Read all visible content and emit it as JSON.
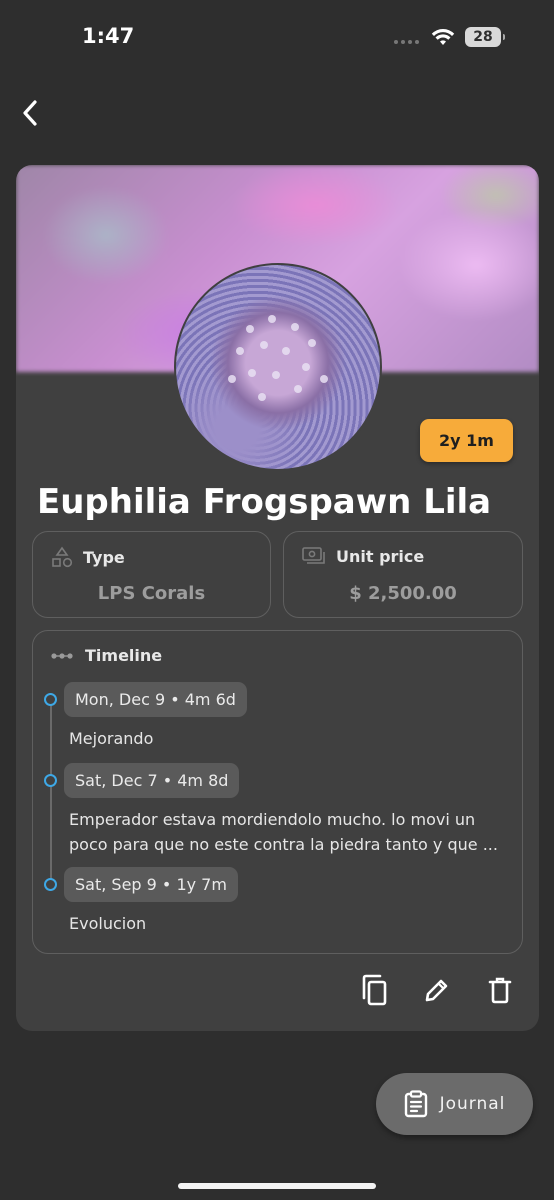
{
  "status_bar": {
    "time": "1:47",
    "battery": "28"
  },
  "nav": {
    "back_icon": "chevron-left-icon"
  },
  "coral": {
    "name": "Euphilia Frogspawn Lila",
    "age_badge": "2y 1m",
    "type_label": "Type",
    "type_value": "LPS Corals",
    "price_label": "Unit price",
    "price_value": "$ 2,500.00"
  },
  "timeline": {
    "label": "Timeline",
    "entries": [
      {
        "date": "Mon, Dec 9 • 4m 6d",
        "note": "Mejorando"
      },
      {
        "date": "Sat, Dec 7 • 4m 8d",
        "note": "Emperador estava mordiendolo mucho. lo movi un poco para que no este contra la piedra tanto y que ..."
      },
      {
        "date": "Sat, Sep 9 • 1y 7m",
        "note": "Evolucion"
      }
    ]
  },
  "actions": {
    "copy_icon": "copy-icon",
    "edit_icon": "pencil-icon",
    "delete_icon": "trash-icon"
  },
  "fab": {
    "label": "Journal",
    "icon": "clipboard-icon"
  },
  "colors": {
    "accent_badge": "#f7ab3a",
    "timeline_dot": "#3ea8e6",
    "background": "#2e2e2e",
    "card": "#404040"
  }
}
